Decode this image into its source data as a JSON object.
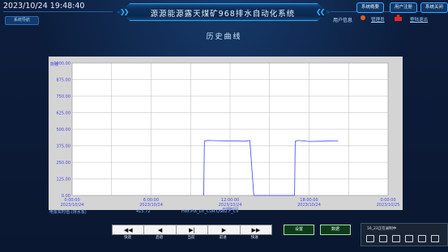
{
  "header": {
    "datetime": "2023/10/24 19:48:40",
    "title": "源源能源露天煤矿968排水自动化系统",
    "left_button": "系统导航",
    "buttons": [
      "系统概要",
      "用户注册",
      "系统关闭"
    ],
    "user_label": "用户信息",
    "user_name": "管理员",
    "logout": "登陆退出"
  },
  "page": {
    "title": "历史曲线"
  },
  "chart_data": {
    "type": "line",
    "ylabel": "数值",
    "ylim": [
      0,
      1000
    ],
    "yticks": [
      "1000.00",
      "875.00",
      "750.00",
      "625.00",
      "500.00",
      "375.00",
      "250.00",
      "125.00",
      "0.00"
    ],
    "x_ticks": [
      {
        "time": "0:00:00",
        "date": "2023/10/24"
      },
      {
        "time": "6:00:00",
        "date": "2023/10/24"
      },
      {
        "time": "12:00:00",
        "date": "2023/10/24"
      },
      {
        "time": "18:00:00",
        "date": "2023/10/24"
      },
      {
        "time": "0:00:00",
        "date": "2023/10/25"
      }
    ],
    "xlabel": "日期时间",
    "series": [
      {
        "color": "#4040ff",
        "points": [
          [
            10.0,
            0
          ],
          [
            10.05,
            410
          ],
          [
            10.3,
            415
          ],
          [
            11.5,
            412
          ],
          [
            13.2,
            410
          ],
          [
            13.5,
            415
          ],
          [
            13.8,
            0
          ],
          [
            16.9,
            0
          ],
          [
            16.95,
            410
          ],
          [
            17.2,
            415
          ],
          [
            18.0,
            408
          ],
          [
            19.0,
            410
          ],
          [
            20.0,
            412
          ],
          [
            20.2,
            412
          ]
        ]
      }
    ],
    "grid": true
  },
  "footer": {
    "item_label": "电泵实时值-(排水泵)",
    "value": "415.72",
    "tag": "Hist.PIX_DY_CUR.QSB2.F_CV"
  },
  "controls": {
    "buttons": [
      "◀◀",
      "◀",
      "▶|",
      "▶",
      "▶▶"
    ],
    "labels": [
      "快退",
      "后退",
      "当前",
      "前进",
      "快进"
    ],
    "set_button": "设置",
    "data_button": "数据"
  },
  "taskbar": {
    "text": "16_23正在录制中"
  },
  "colors": {
    "accent": "#3aa0e8",
    "chart_line": "#4040ff",
    "chart_bg": "#d4d4d4"
  }
}
